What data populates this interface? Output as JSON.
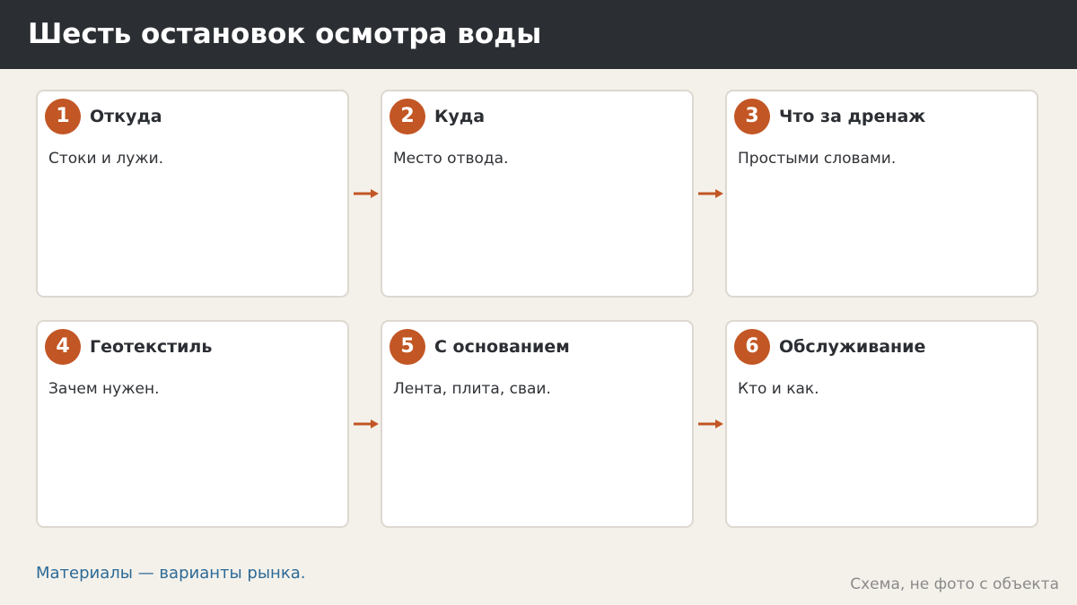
{
  "header": {
    "title": "Шесть остановок осмотра воды"
  },
  "cards": [
    {
      "number": "1",
      "title": "Откуда",
      "description": "Стоки и лужи."
    },
    {
      "number": "2",
      "title": "Куда",
      "description": "Место отвода."
    },
    {
      "number": "3",
      "title": "Что за дренаж",
      "description": "Простыми словами."
    },
    {
      "number": "4",
      "title": "Геотекстиль",
      "description": "Зачем нужен."
    },
    {
      "number": "5",
      "title": "С основанием",
      "description": "Лента, плита, сваи."
    },
    {
      "number": "6",
      "title": "Обслуживание",
      "description": "Кто и как."
    }
  ],
  "footer": {
    "note": "Материалы — варианты рынка.",
    "caption": "Схема, не фото с объекта"
  },
  "colors": {
    "header_bg": "#2b2e33",
    "accent": "#c25624",
    "note": "#2d6a96",
    "page_bg": "#f4f1eb"
  },
  "icons": {
    "flow_arrow": "arrow-right-icon"
  }
}
